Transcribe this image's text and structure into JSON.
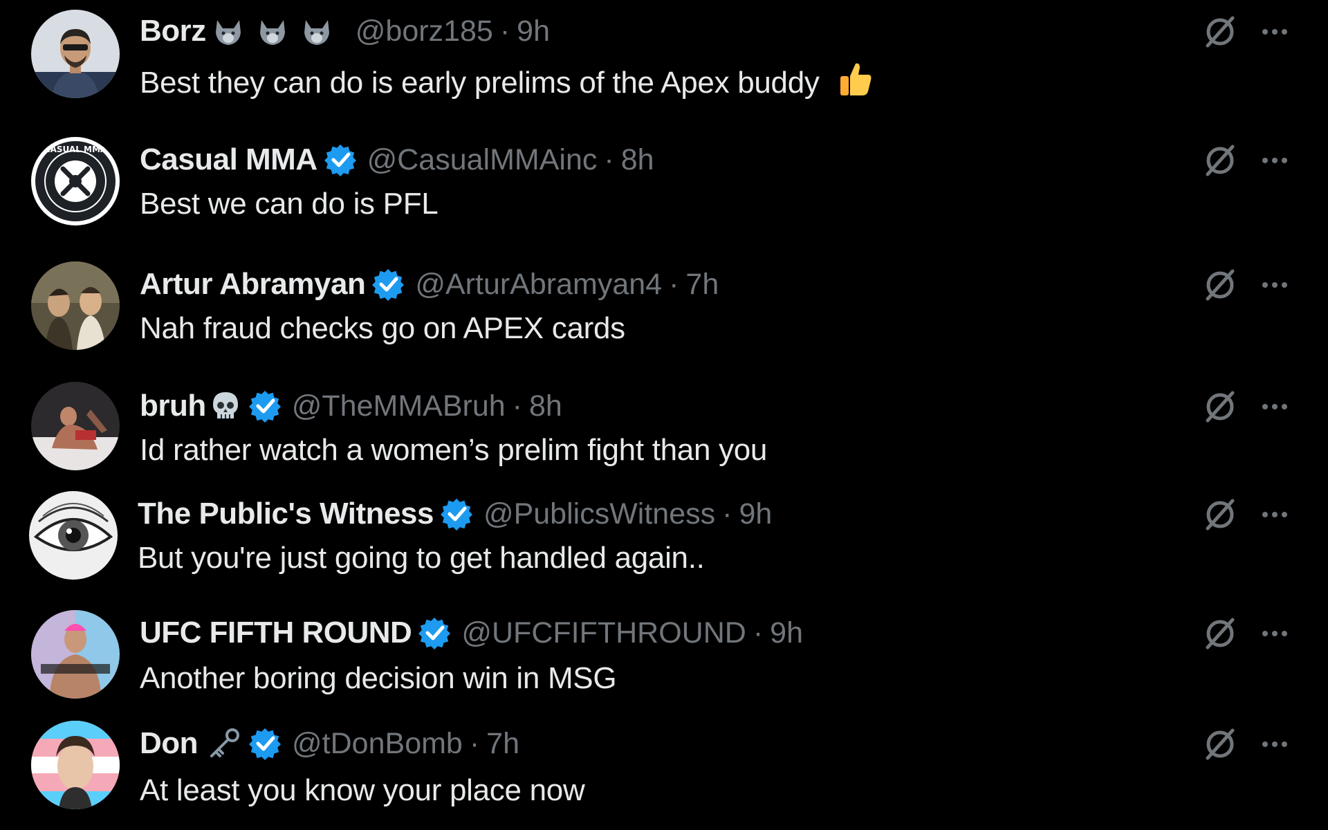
{
  "replies": [
    {
      "name": "Borz",
      "handle": "@borz185",
      "separator": "·",
      "time": "9h",
      "text": "Best they can do is early prelims of the Apex buddy",
      "verified": false,
      "avatar_icon": "person-photo-avatar",
      "name_decoration": "wolf-emoji-x3",
      "text_emoji": "thumbs-up-emoji"
    },
    {
      "name": "Casual MMA",
      "handle": "@CasualMMAinc",
      "separator": "·",
      "time": "8h",
      "text": "Best we can do is PFL",
      "verified": true,
      "avatar_icon": "casual-mma-logo-avatar",
      "avatar_text": "CASUAL MMA"
    },
    {
      "name": "Artur Abramyan",
      "handle": "@ArturAbramyan4",
      "separator": "·",
      "time": "7h",
      "text": "Nah fraud checks go on APEX cards",
      "verified": true,
      "avatar_icon": "group-photo-avatar"
    },
    {
      "name": "bruh",
      "handle": "@TheMMABruh",
      "separator": "·",
      "time": "8h",
      "text": "Id rather watch a women’s prelim fight than you",
      "verified": true,
      "avatar_icon": "fight-photo-avatar",
      "name_decoration": "skull-emoji"
    },
    {
      "name": "The Public's Witness",
      "handle": "@PublicsWitness",
      "separator": "·",
      "time": "9h",
      "text": "But you're just going to get handled again..",
      "verified": true,
      "avatar_icon": "eye-engraving-avatar"
    },
    {
      "name": "UFC FIFTH ROUND",
      "handle": "@UFCFIFTHROUND",
      "separator": "·",
      "time": "9h",
      "text": "Another boring decision win in MSG",
      "verified": true,
      "avatar_icon": "fighter-neon-avatar"
    },
    {
      "name": "Don",
      "handle": "@tDonBomb",
      "separator": "·",
      "time": "7h",
      "text": "At least you know your place now",
      "verified": true,
      "avatar_icon": "cartoon-man-avatar",
      "name_decoration": "key-emoji"
    }
  ],
  "colors": {
    "background": "#000000",
    "primary_text": "#e7e9ea",
    "secondary_text": "#71767b",
    "verified_blue": "#1d9bf0"
  },
  "icons": {
    "verified": "verified-badge-icon",
    "grok": "grok-slash-icon",
    "more": "more-dots-icon"
  }
}
